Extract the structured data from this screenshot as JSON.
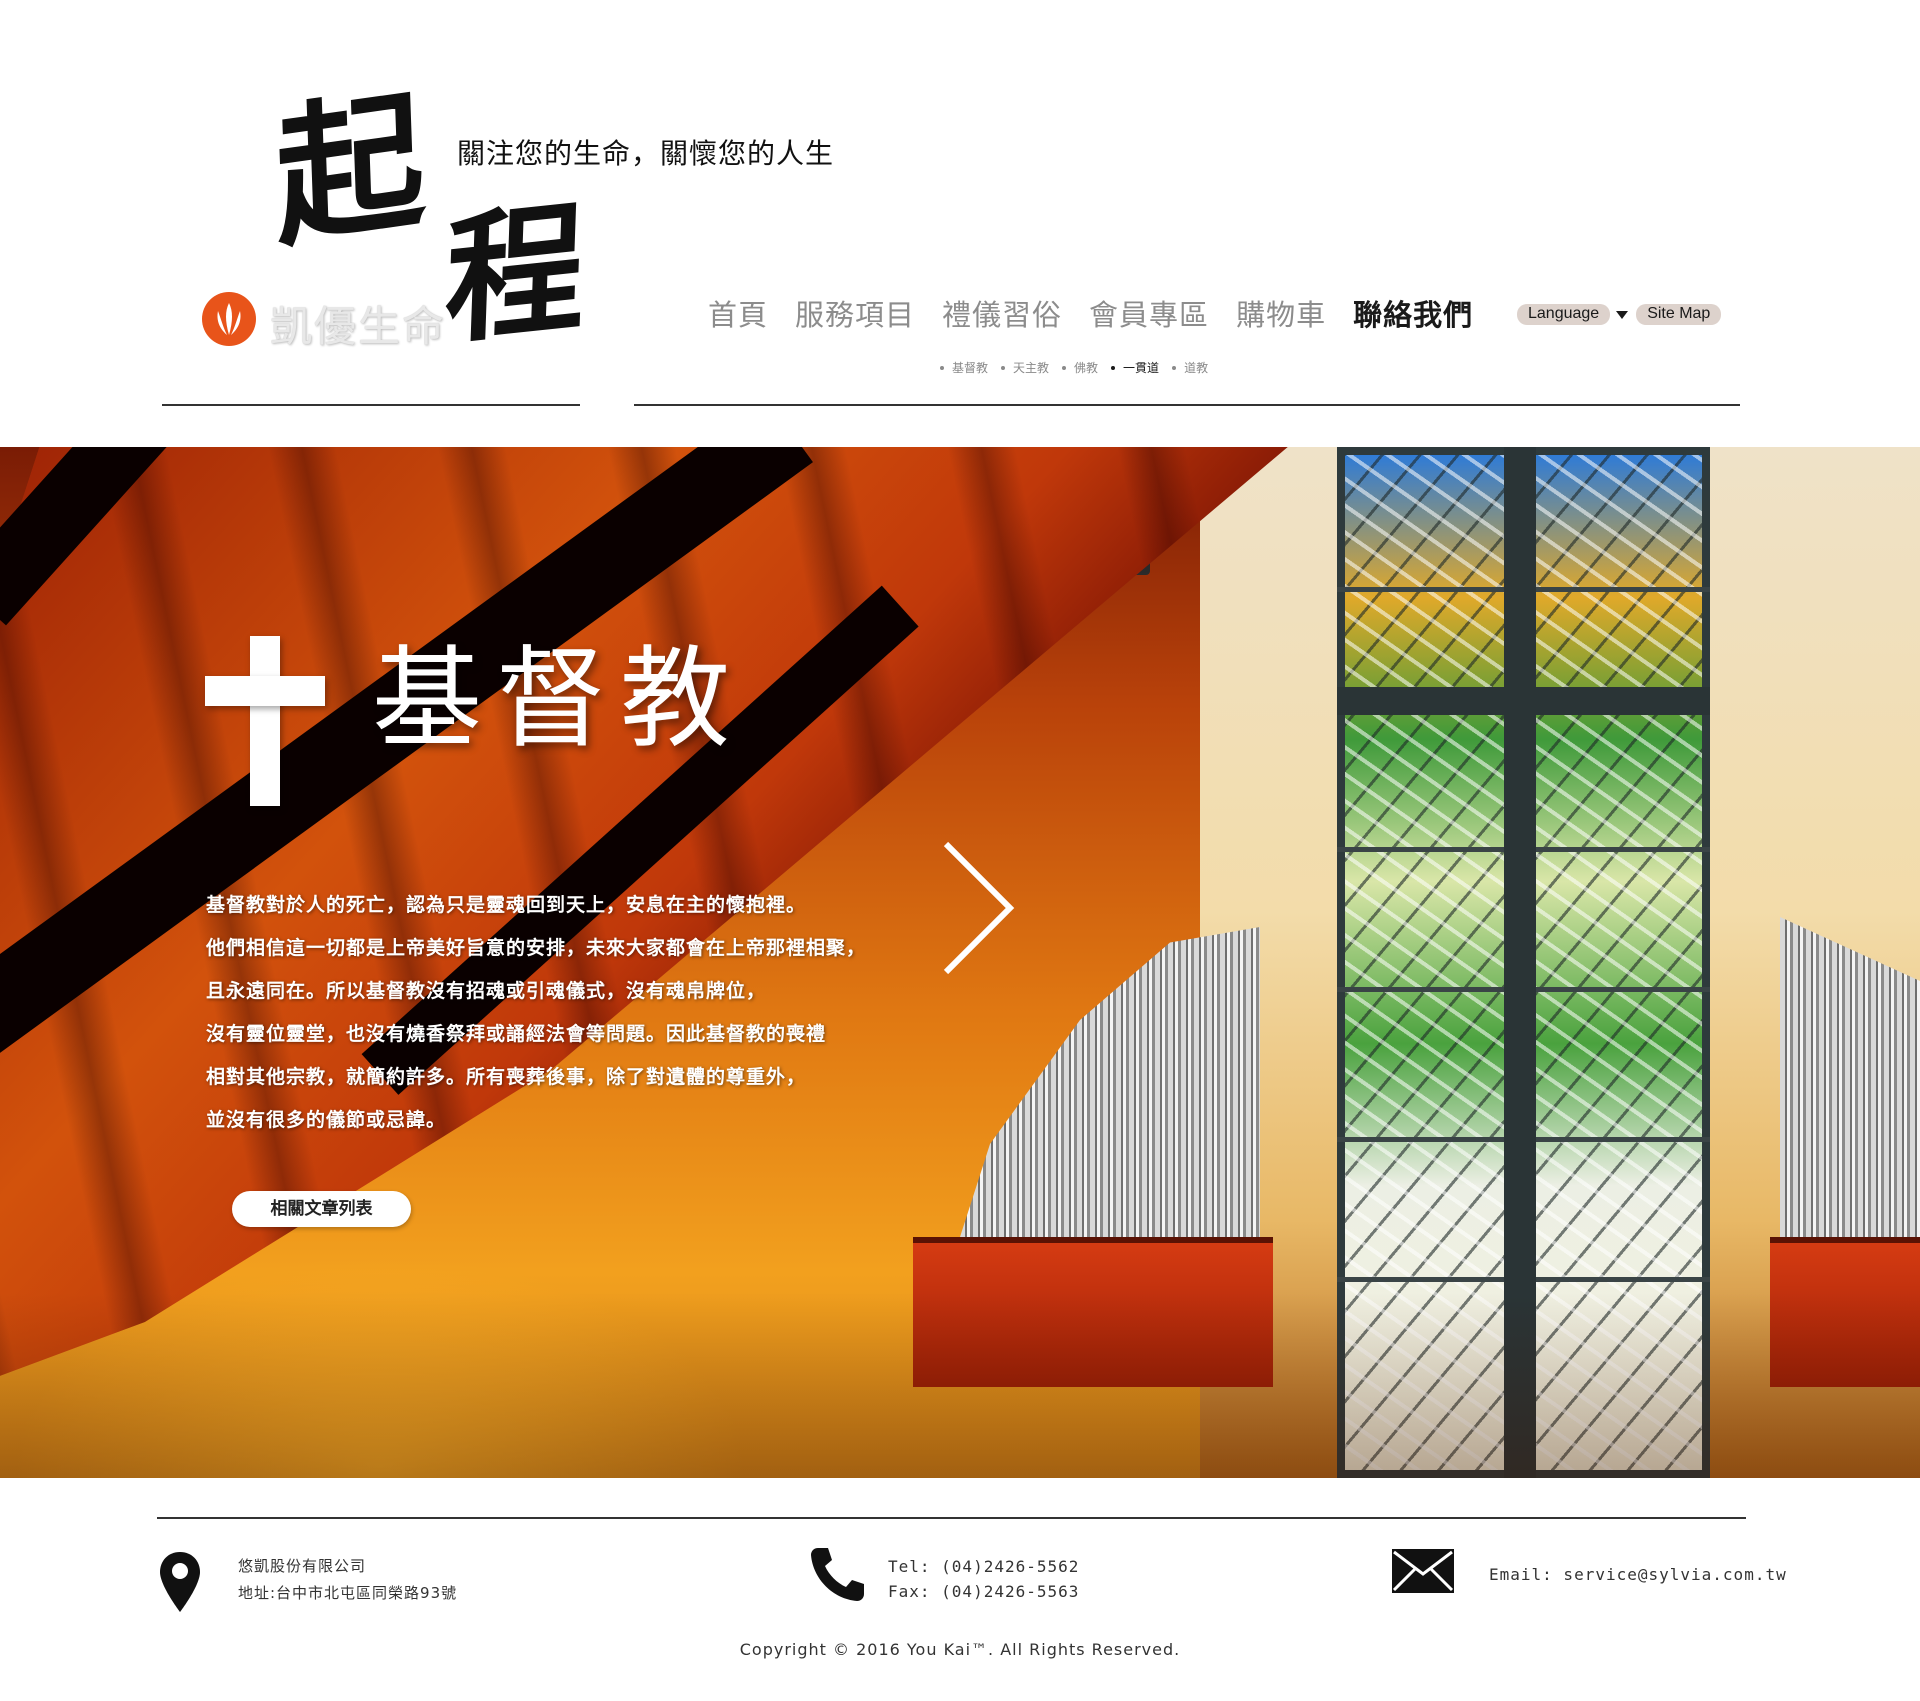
{
  "header": {
    "logo_char_1": "起",
    "logo_char_2": "程",
    "tagline": "關注您的生命，關懷您的人生",
    "brand_name": "凱優生命",
    "brand_color": "#e8541a"
  },
  "nav": {
    "items": [
      {
        "label": "首頁",
        "active": false
      },
      {
        "label": "服務項目",
        "active": false
      },
      {
        "label": "禮儀習俗",
        "active": false
      },
      {
        "label": "會員專區",
        "active": false
      },
      {
        "label": "購物車",
        "active": false
      },
      {
        "label": "聯絡我們",
        "active": true
      }
    ],
    "language_label": "Language",
    "sitemap_label": "Site Map"
  },
  "sub_nav": {
    "items": [
      {
        "label": "基督教",
        "active": false
      },
      {
        "label": "天主教",
        "active": false
      },
      {
        "label": "佛教",
        "active": false
      },
      {
        "label": "一貫道",
        "active": true
      },
      {
        "label": "道教",
        "active": false
      }
    ]
  },
  "hero": {
    "title": "基督教",
    "icon": "cross-icon",
    "description_lines": [
      "基督教對於人的死亡，認為只是靈魂回到天上，安息在主的懷抱裡。",
      "他們相信這一切都是上帝美好旨意的安排，未來大家都會在上帝那裡相聚，",
      "且永遠同在。所以基督教沒有招魂或引魂儀式，沒有魂帛牌位，",
      "沒有靈位靈堂，也沒有燒香祭拜或誦經法會等問題。因此基督教的喪禮",
      "相對其他宗教，就簡約許多。所有喪葬後事，除了對遺體的尊重外，",
      "並沒有很多的儀節或忌諱。"
    ],
    "articles_button": "相關文章列表",
    "next_icon": "chevron-right-icon"
  },
  "footer": {
    "company_name": "悠凱股份有限公司",
    "address": "地址:台中市北屯區同榮路93號",
    "tel": "Tel: (04)2426-5562",
    "fax": "Fax: (04)2426-5563",
    "email": "Email: service@sylvia.com.tw",
    "copyright": "Copyright © 2016 You Kai™. All Rights Reserved."
  }
}
